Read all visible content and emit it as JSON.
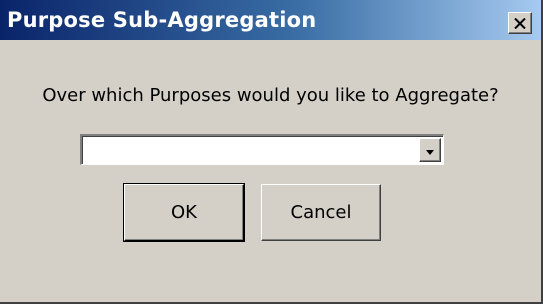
{
  "window": {
    "title": "Purpose Sub-Aggregation",
    "close_icon": "close-icon"
  },
  "dialog": {
    "prompt": "Over which Purposes would you like to Aggregate?",
    "purpose_select": {
      "value": "",
      "arrow_icon": "chevron-down-icon"
    },
    "ok_label": "OK",
    "cancel_label": "Cancel"
  },
  "colors": {
    "titlebar_start": "#0a246a",
    "titlebar_end": "#a6caf0",
    "face": "#d4d0c8"
  }
}
